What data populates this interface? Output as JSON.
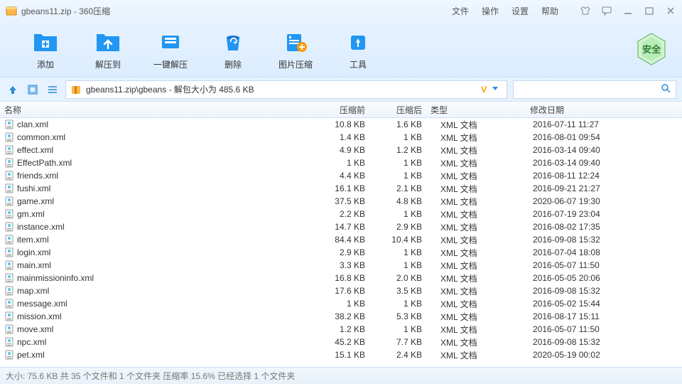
{
  "window": {
    "title": "gbeans11.zip - 360压缩"
  },
  "menu": {
    "file": "文件",
    "action": "操作",
    "settings": "设置",
    "help": "帮助"
  },
  "toolbar": {
    "add": "添加",
    "extract": "解压到",
    "oneclick": "一键解压",
    "delete": "删除",
    "imgcompress": "图片压缩",
    "tools": "工具"
  },
  "safe": "安全",
  "path": "gbeans11.zip\\gbeans - 解包大小为 485.6 KB",
  "columns": {
    "name": "名称",
    "before": "压缩前",
    "after": "压缩后",
    "type": "类型",
    "date": "修改日期"
  },
  "files": [
    {
      "name": "clan.xml",
      "before": "10.8 KB",
      "after": "1.6 KB",
      "type": "XML 文档",
      "date": "2016-07-11 11:27"
    },
    {
      "name": "common.xml",
      "before": "1.4 KB",
      "after": "1 KB",
      "type": "XML 文档",
      "date": "2016-08-01 09:54"
    },
    {
      "name": "effect.xml",
      "before": "4.9 KB",
      "after": "1.2 KB",
      "type": "XML 文档",
      "date": "2016-03-14 09:40"
    },
    {
      "name": "EffectPath.xml",
      "before": "1 KB",
      "after": "1 KB",
      "type": "XML 文档",
      "date": "2016-03-14 09:40"
    },
    {
      "name": "friends.xml",
      "before": "4.4 KB",
      "after": "1 KB",
      "type": "XML 文档",
      "date": "2016-08-11 12:24"
    },
    {
      "name": "fushi.xml",
      "before": "16.1 KB",
      "after": "2.1 KB",
      "type": "XML 文档",
      "date": "2016-09-21 21:27"
    },
    {
      "name": "game.xml",
      "before": "37.5 KB",
      "after": "4.8 KB",
      "type": "XML 文档",
      "date": "2020-06-07 19:30"
    },
    {
      "name": "gm.xml",
      "before": "2.2 KB",
      "after": "1 KB",
      "type": "XML 文档",
      "date": "2016-07-19 23:04"
    },
    {
      "name": "instance.xml",
      "before": "14.7 KB",
      "after": "2.9 KB",
      "type": "XML 文档",
      "date": "2016-08-02 17:35"
    },
    {
      "name": "item.xml",
      "before": "84.4 KB",
      "after": "10.4 KB",
      "type": "XML 文档",
      "date": "2016-09-08 15:32"
    },
    {
      "name": "login.xml",
      "before": "2.9 KB",
      "after": "1 KB",
      "type": "XML 文档",
      "date": "2016-07-04 18:08"
    },
    {
      "name": "main.xml",
      "before": "3.3 KB",
      "after": "1 KB",
      "type": "XML 文档",
      "date": "2016-05-07 11:50"
    },
    {
      "name": "mainmissioninfo.xml",
      "before": "16.8 KB",
      "after": "2.0 KB",
      "type": "XML 文档",
      "date": "2016-05-05 20:06"
    },
    {
      "name": "map.xml",
      "before": "17.6 KB",
      "after": "3.5 KB",
      "type": "XML 文档",
      "date": "2016-09-08 15:32"
    },
    {
      "name": "message.xml",
      "before": "1 KB",
      "after": "1 KB",
      "type": "XML 文档",
      "date": "2016-05-02 15:44"
    },
    {
      "name": "mission.xml",
      "before": "38.2 KB",
      "after": "5.3 KB",
      "type": "XML 文档",
      "date": "2016-08-17 15:11"
    },
    {
      "name": "move.xml",
      "before": "1.2 KB",
      "after": "1 KB",
      "type": "XML 文档",
      "date": "2016-05-07 11:50"
    },
    {
      "name": "npc.xml",
      "before": "45.2 KB",
      "after": "7.7 KB",
      "type": "XML 文档",
      "date": "2016-09-08 15:32"
    },
    {
      "name": "pet.xml",
      "before": "15.1 KB",
      "after": "2.4 KB",
      "type": "XML 文档",
      "date": "2020-05-19 00:02"
    }
  ],
  "status": "大小: 75.6 KB 共 35 个文件和 1 个文件夹 压缩率 15.6%  已经选择 1 个文件夹"
}
